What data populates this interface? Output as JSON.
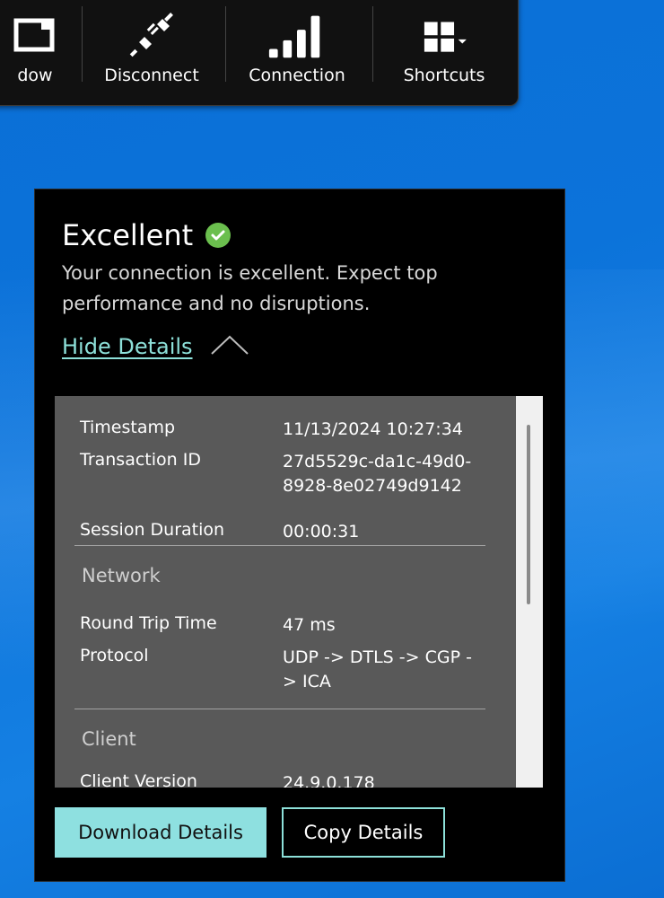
{
  "toolbar": {
    "items": [
      {
        "label": "dow",
        "icon": "window-icon"
      },
      {
        "label": "Disconnect",
        "icon": "disconnect-plug-icon"
      },
      {
        "label": "Connection",
        "icon": "signal-bars-icon"
      },
      {
        "label": "Shortcuts",
        "icon": "grid-dropdown-icon"
      }
    ]
  },
  "panel": {
    "status_title": "Excellent",
    "status_icon": "check-circle-icon",
    "status_color": "#6bbf4e",
    "description": "Your connection is excellent. Expect top performance and no disruptions.",
    "hide_details_label": "Hide Details",
    "details": {
      "general": [
        {
          "key": "Timestamp",
          "value": "11/13/2024 10:27:34"
        },
        {
          "key": "Transaction ID",
          "value": "27d5529c-da1c-49d0-8928-8e02749d9142"
        },
        {
          "key": "Session Duration",
          "value": "00:00:31"
        }
      ],
      "network": {
        "heading": "Network",
        "rows": [
          {
            "key": "Round Trip Time",
            "value": "47 ms"
          },
          {
            "key": "Protocol",
            "value": "UDP -> DTLS -> CGP -> ICA"
          }
        ]
      },
      "client": {
        "heading": "Client",
        "rows": [
          {
            "key": "Client Version",
            "value": "24.9.0.178"
          }
        ]
      }
    },
    "buttons": {
      "download": "Download Details",
      "copy": "Copy Details"
    },
    "accent_color": "#8de0d9"
  }
}
